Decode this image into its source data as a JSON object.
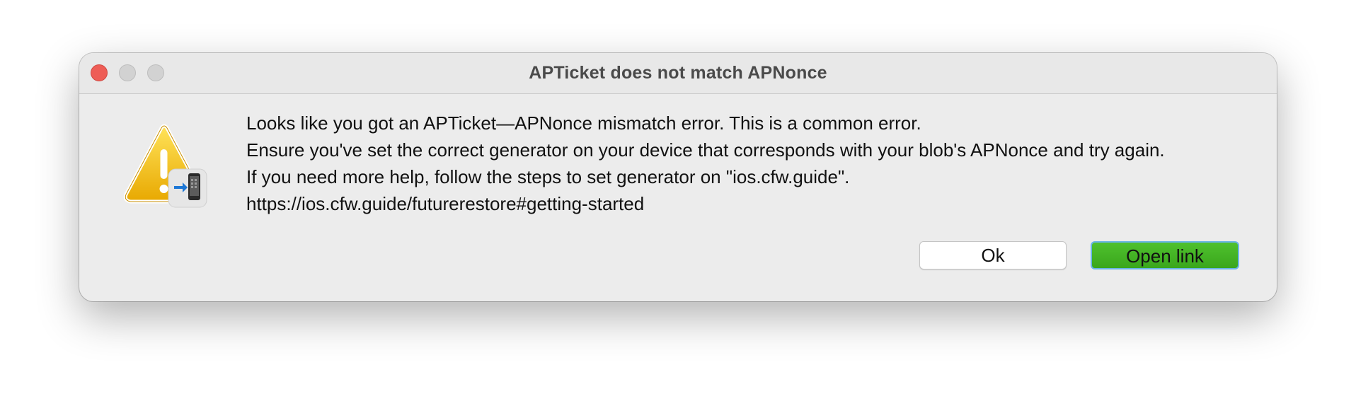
{
  "dialog": {
    "title": "APTicket does not match APNonce",
    "message_lines": [
      "Looks like you got an APTicket—APNonce mismatch error. This is a common error.",
      "Ensure you've set the correct generator on your device that corresponds with your blob's APNonce and try again.",
      "If you need more help, follow the steps to set generator on \"ios.cfw.guide\".",
      "https://ios.cfw.guide/futurerestore#getting-started"
    ],
    "buttons": {
      "ok_label": "Ok",
      "open_link_label": "Open link"
    },
    "icon": "warning-icon",
    "badge_icon": "phone-transfer-icon"
  },
  "colors": {
    "close": "#ee5d56",
    "window_bg": "#ececec",
    "primary_button": "#3aa61c",
    "focus_ring": "#6ab4e6",
    "warning_yellow": "#f2c200"
  }
}
